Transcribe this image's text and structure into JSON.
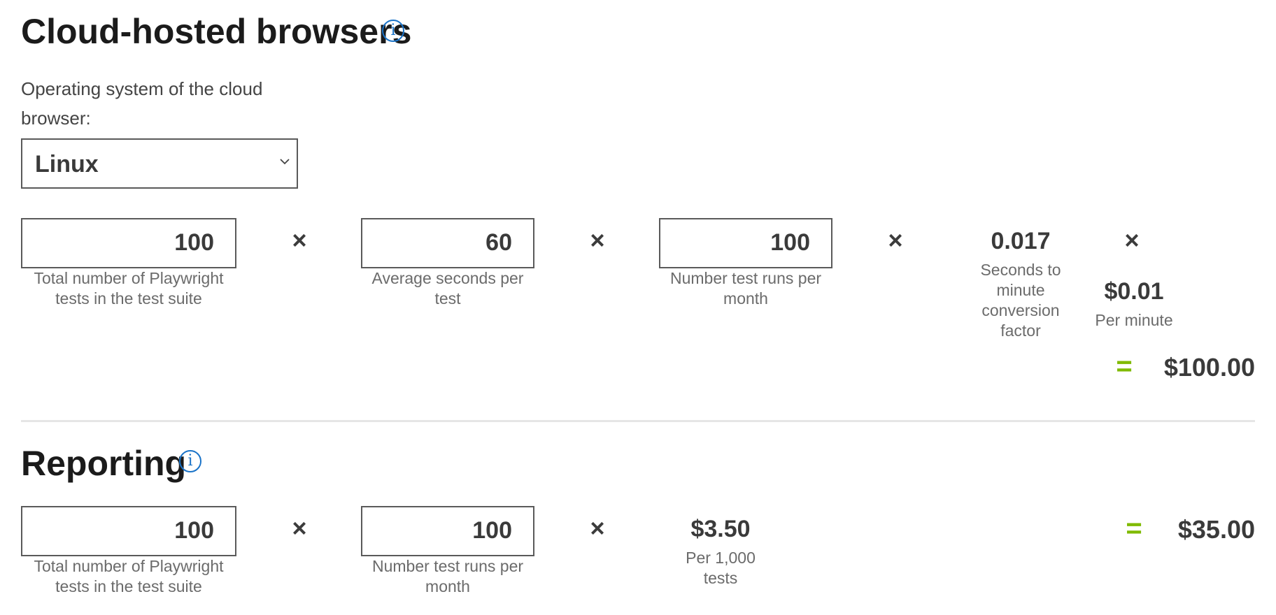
{
  "cloud": {
    "title": "Cloud-hosted browsers",
    "info_icon": "i",
    "os_label": "Operating system of the cloud browser:",
    "os_selected": "Linux",
    "tests_value": "100",
    "tests_caption": "Total number of Playwright tests in the test suite",
    "seconds_value": "60",
    "seconds_caption": "Average seconds per test",
    "runs_value": "100",
    "runs_caption": "Number test runs per month",
    "factor_value": "0.017",
    "factor_caption": "Seconds to minute conversion factor",
    "price_value": "$0.01",
    "price_caption": "Per minute",
    "multiply_symbol": "×",
    "equals_symbol": "=",
    "total": "$100.00"
  },
  "reporting": {
    "title": "Reporting",
    "info_icon": "i",
    "tests_value": "100",
    "tests_caption": "Total number of Playwright tests in the test suite",
    "runs_value": "100",
    "runs_caption": "Number test runs per month",
    "price_value": "$3.50",
    "price_caption": "Per 1,000 tests",
    "multiply_symbol": "×",
    "equals_symbol": "=",
    "total": "$35.00"
  },
  "colors": {
    "accent_info": "#1a73c8",
    "equals_green": "#7fba00",
    "text_dark": "#1b1b1b",
    "caption_gray": "#6b6b6b",
    "border_gray": "#5a5a5a"
  },
  "icons": [
    "info-icon",
    "chevron-down-icon",
    "multiply-icon",
    "equals-icon"
  ]
}
